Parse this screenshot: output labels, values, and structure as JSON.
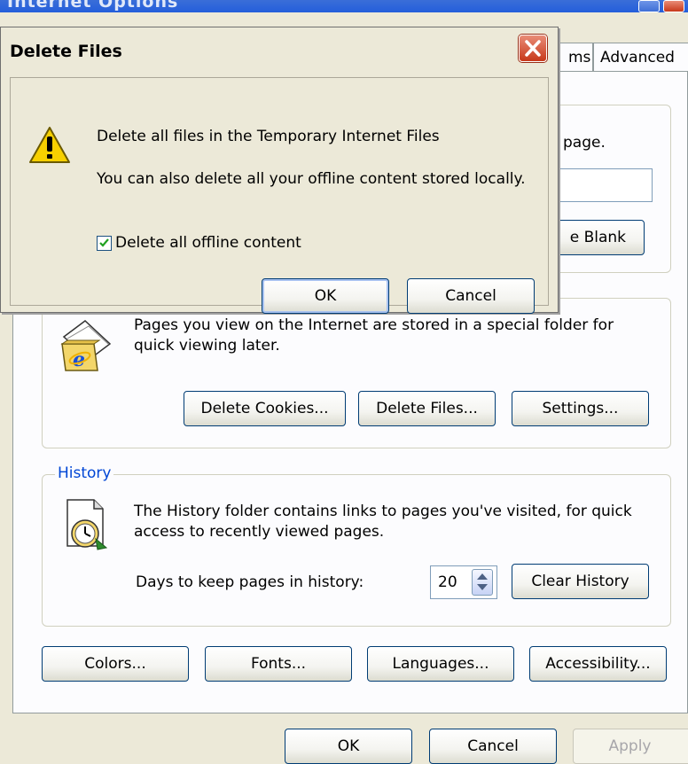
{
  "parent_window": {
    "title": "Internet Options"
  },
  "tabs": [
    {
      "label": "ms"
    },
    {
      "label": "Advanced"
    }
  ],
  "home_page": {
    "text_fragment": "page.",
    "use_blank_button": "e Blank"
  },
  "temporary_files": {
    "description": "Pages you view on the Internet are stored in a special folder for quick viewing later.",
    "delete_cookies_button": "Delete Cookies...",
    "delete_files_button": "Delete Files...",
    "settings_button": "Settings..."
  },
  "history": {
    "caption": "History",
    "description": "The History folder contains links to pages you've visited, for quick access to recently viewed pages.",
    "days_label": "Days to keep pages in history:",
    "days_value": "20",
    "clear_button": "Clear History"
  },
  "bottom_row": {
    "colors": "Colors...",
    "fonts": "Fonts...",
    "languages": "Languages...",
    "accessibility": "Accessibility..."
  },
  "footer": {
    "ok": "OK",
    "cancel": "Cancel",
    "apply": "Apply"
  },
  "delete_dialog": {
    "title": "Delete Files",
    "message1": "Delete all files in the Temporary Internet Files",
    "message2": "You can also delete all your offline content stored locally.",
    "checkbox_label": "Delete all offline content",
    "checkbox_checked": true,
    "ok": "OK",
    "cancel": "Cancel"
  },
  "icons": {
    "warning": "warning-icon",
    "ie_folder": "ie-folder-icon",
    "history_clock": "history-clock-icon",
    "close": "close-icon"
  }
}
